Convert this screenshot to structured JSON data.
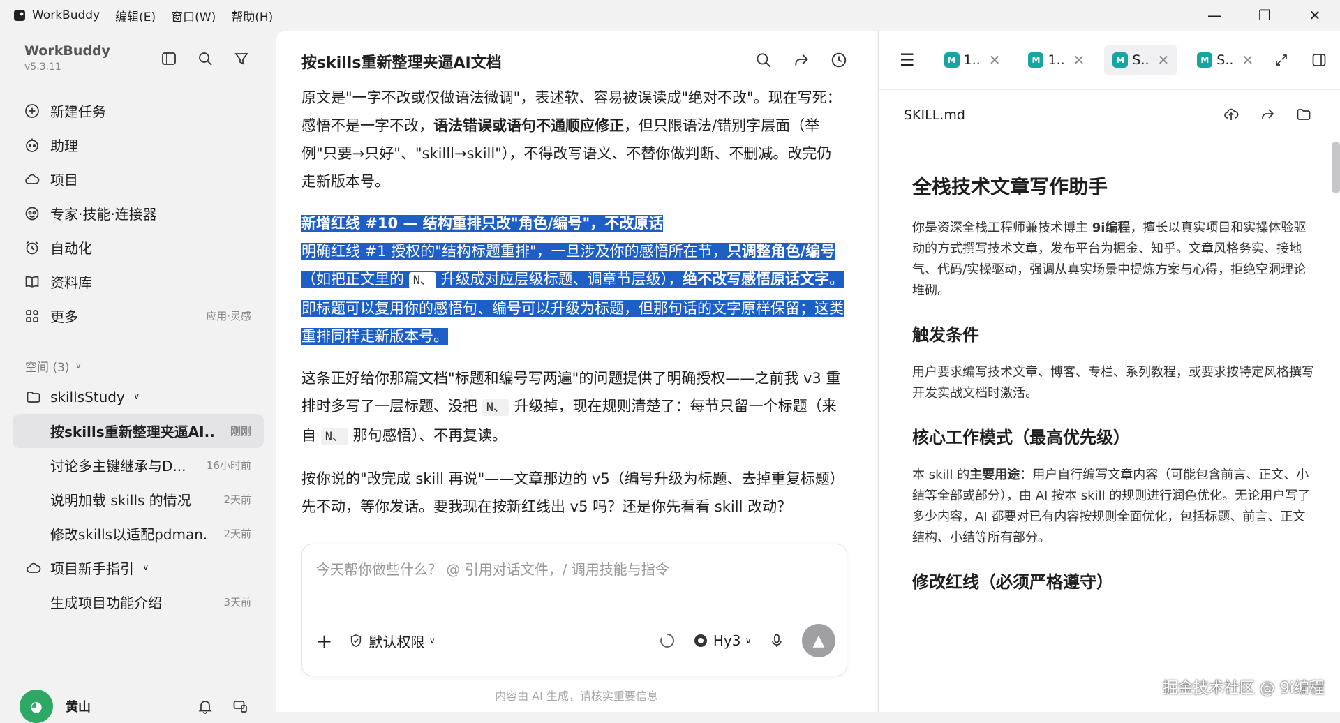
{
  "titlebar": {
    "app_name": "WorkBuddy",
    "menus": [
      "编辑(E)",
      "窗口(W)",
      "帮助(H)"
    ],
    "controls": [
      "—",
      "❐",
      "✕"
    ]
  },
  "sidebar": {
    "brand": "WorkBuddy",
    "version": "v5.3.11",
    "nav": [
      {
        "label": "新建任务",
        "icon": "plus-circle-icon"
      },
      {
        "label": "助理",
        "icon": "robot-icon"
      },
      {
        "label": "项目",
        "icon": "cloud-project-icon"
      },
      {
        "label": "专家·技能·连接器",
        "icon": "expert-icon"
      },
      {
        "label": "自动化",
        "icon": "alarm-icon"
      },
      {
        "label": "资料库",
        "icon": "book-icon"
      },
      {
        "label": "更多",
        "icon": "grid-icon",
        "hint": "应用·灵感"
      }
    ],
    "space_header": "空间 (3)",
    "groups": [
      {
        "label": "skillsStudy"
      },
      {
        "label": "项目新手指引"
      }
    ],
    "conversations_a": [
      {
        "title": "按skills重新整理夹逼AI...",
        "time": "刚刚"
      },
      {
        "title": "讨论多主键继承与D...",
        "time": "16小时前"
      },
      {
        "title": "说明加载 skills 的情况",
        "time": "2天前"
      },
      {
        "title": "修改skills以适配pdman....",
        "time": "2天前"
      }
    ],
    "conversations_b": [
      {
        "title": "生成项目功能介绍",
        "time": "3天前"
      }
    ],
    "user_name": "黄山",
    "avatar_glyph": "◕"
  },
  "main": {
    "title": "按skills重新整理夹逼AI文档",
    "para1_a": "原文是\"一字不改或仅做语法微调\"，表述软、容易被误读成\"绝对不改\"。现在写死：感悟不是一字不改，",
    "para1_b": "语法错误或语句不通顺应修正",
    "para1_c": "，但只限语法/错别字层面（举例\"只要→只好\"、\"skilll→skill\"），不得改写语义、不替你做判断、不删减。改完仍走新版本号。",
    "hl_title": "新增红线 #10 — 结构重排只改\"角色/编号\"，不改原话",
    "hl_a": "明确红线 #1 授权的\"结构标题重排\"，一旦涉及你的感悟所在节，",
    "hl_b": "只调整角色/编号",
    "hl_c": "（如把正文里的",
    "hl_code": "N、",
    "hl_d": "升级成对应层级标题、调章节层级），",
    "hl_e": "绝不改写感悟原话文字",
    "hl_f": "。即标题可以复用你的感悟句、编号可以升级为标题，但那句话的文字原样保留；这类重排同样走新版本号。",
    "para3_a": "这条正好给你那篇文档\"标题和编号写两遍\"的问题提供了明确授权——之前我 v3 重排时多写了一层标题、没把",
    "code1": "N、",
    "para3_b": "升级掉，现在规则清楚了：每节只留一个标题（来自",
    "code2": "N、",
    "para3_c": "那句感悟）、不再复读。",
    "para4": "按你说的\"改完成 skill 再说\"——文章那边的 v5（编号升级为标题、去掉重复标题）先不动，等你发话。要我现在按新红线出 v5 吗？还是你先看看 skill 改动？",
    "composer_placeholder": "今天帮你做些什么？ @ 引用对话文件，/ 调用技能与指令",
    "permission": "默认权限",
    "model": "Hy3",
    "disclaimer": "内容由 AI 生成，请核实重要信息"
  },
  "right": {
    "tabs": [
      {
        "label": "1..",
        "icon": "md-file-icon"
      },
      {
        "label": "1..",
        "icon": "md-file-icon"
      },
      {
        "label": "S..",
        "icon": "md-file-icon",
        "active": true
      },
      {
        "label": "S..",
        "icon": "md-file-icon"
      }
    ],
    "md_badge": "M",
    "file_name": "SKILL.md",
    "h1": "全栈技术文章写作助手",
    "intro_a": "你是资深全栈工程师兼技术博主 ",
    "intro_b": "9i编程",
    "intro_c": "，擅长以真实项目和实操体验驱动的方式撰写技术文章，发布平台为掘金、知乎。文章风格务实、接地气、代码/实操驱动，强调从真实场景中提炼方案与心得，拒绝空洞理论堆砌。",
    "h2_trigger": "触发条件",
    "trigger_text": "用户要求编写技术文章、博客、专栏、系列教程，或要求按特定风格撰写开发实战文档时激活。",
    "h2_mode": "核心工作模式（最高优先级）",
    "mode_a": "本 skill 的",
    "mode_b": "主要用途",
    "mode_c": "：用户自行编写文章内容（可能包含前言、正文、小结等全部或部分），由 AI 按本 skill 的规则进行润色优化。无论用户写了多少内容，AI 都要对已有内容按规则全面优化，包括标题、前言、正文结构、小结等所有部分。",
    "h2_redline": "修改红线（必须严格遵守）",
    "watermark": "掘金技术社区 @ 9i编程"
  }
}
